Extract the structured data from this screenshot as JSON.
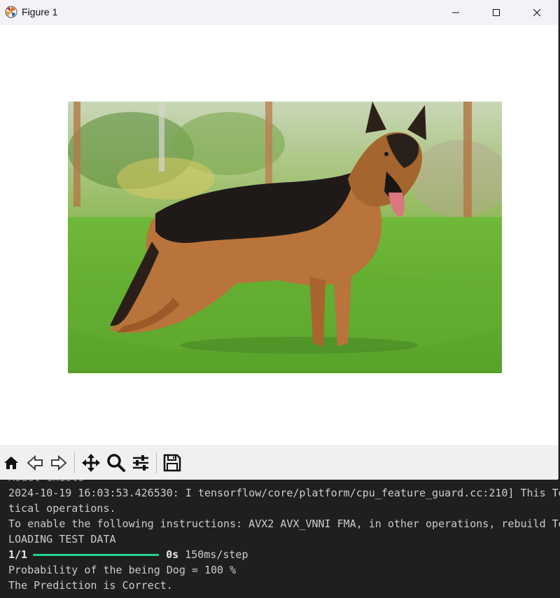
{
  "window": {
    "title": "Figure 1",
    "icon": "matplotlib-logo-icon"
  },
  "window_controls": {
    "minimize": "minimize-icon",
    "maximize": "maximize-icon",
    "close": "close-icon"
  },
  "figure": {
    "image": "photo of a german shepherd dog standing on grass"
  },
  "toolbar": {
    "buttons": [
      "home-icon",
      "back-icon",
      "forward-icon",
      "pan-icon",
      "zoom-icon",
      "configure-subplots-icon",
      "save-icon"
    ]
  },
  "terminal": {
    "lines": {
      "l0": "Model exists",
      "l1": "2024-10-19 16:03:53.426530: I tensorflow/core/platform/cpu_feature_guard.cc:210] This Te",
      "l2": "tical operations.",
      "l3": "To enable the following instructions: AVX2 AVX_VNNI FMA, in other operations, rebuild Te",
      "l4": "LOADING TEST DATA",
      "l5_step": "1/1",
      "l5_time": "0s",
      "l5_rate": "150ms/step",
      "l6": "Probability of the being Dog = 100 %",
      "l7": "The Prediction is Correct."
    },
    "progress": 1.0,
    "progress_color": "#23d18b"
  }
}
